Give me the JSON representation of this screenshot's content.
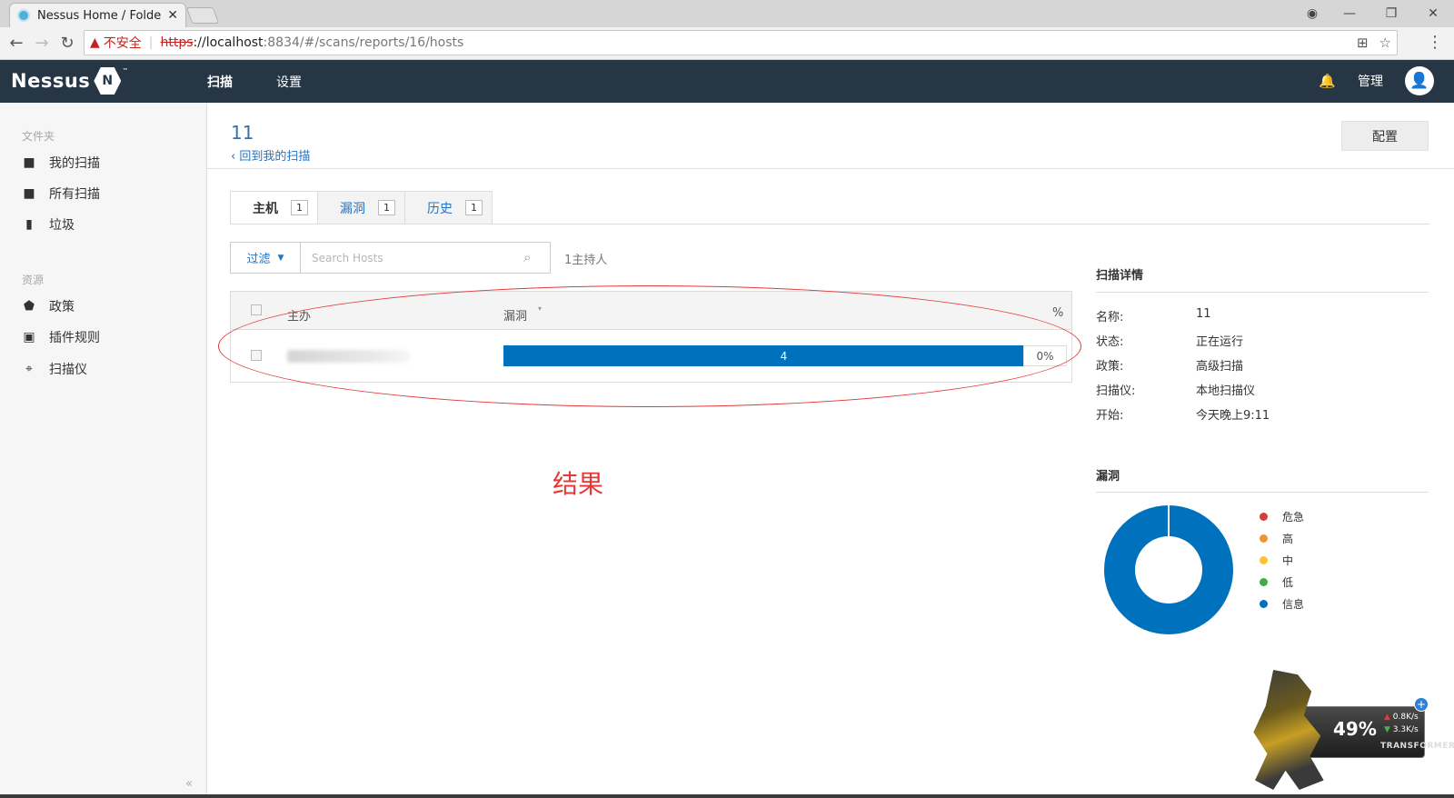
{
  "browser": {
    "tab_title": "Nessus Home / Folders",
    "tab_close": "✕",
    "insecure_label": "不安全",
    "url_scheme": "https",
    "url_host": "://localhost",
    "url_path": ":8834/#/scans/reports/16/hosts"
  },
  "header": {
    "logo_text": "Nessus",
    "logo_badge": "N",
    "logo_tm": "™",
    "nav": {
      "scans": "扫描",
      "settings": "设置"
    },
    "admin": "管理"
  },
  "sidebar": {
    "folders_heading": "文件夹",
    "my_scans": "我的扫描",
    "all_scans": "所有扫描",
    "trash": "垃圾",
    "resources_heading": "资源",
    "policies": "政策",
    "plugin_rules": "插件规则",
    "scanners": "扫描仪"
  },
  "main": {
    "title": "11",
    "back_link": "‹ 回到我的扫描",
    "configure": "配置",
    "tabs": [
      {
        "label": "主机",
        "count": "1"
      },
      {
        "label": "漏洞",
        "count": "1"
      },
      {
        "label": "历史",
        "count": "1"
      }
    ],
    "filter": "过滤",
    "search_placeholder": "Search Hosts",
    "host_count": "1主持人",
    "table": {
      "col_host": "主办",
      "col_vulns": "漏洞",
      "sort_marker": "▾",
      "col_pct": "%",
      "rows": [
        {
          "vuln_count": "4",
          "pct": "0%"
        }
      ]
    },
    "annotation": "结果"
  },
  "scan_details": {
    "heading": "扫描详情",
    "name_label": "名称:",
    "name_value": "11",
    "status_label": "状态:",
    "status_value": "正在运行",
    "policy_label": "政策:",
    "policy_value": "高级扫描",
    "scanner_label": "扫描仪:",
    "scanner_value": "本地扫描仪",
    "start_label": "开始:",
    "start_value": "今天晚上9:11"
  },
  "vulnerabilities": {
    "heading": "漏洞",
    "legend": [
      {
        "label": "危急",
        "color": "#d43f3a"
      },
      {
        "label": "高",
        "color": "#ee9336"
      },
      {
        "label": "中",
        "color": "#fdc431"
      },
      {
        "label": "低",
        "color": "#3fae49"
      },
      {
        "label": "信息",
        "color": "#0071bc"
      }
    ]
  },
  "widget": {
    "cpu": "49%",
    "upload": "0.8K/s",
    "download": "3.3K/s",
    "brand": "TRANSFORMERS"
  }
}
